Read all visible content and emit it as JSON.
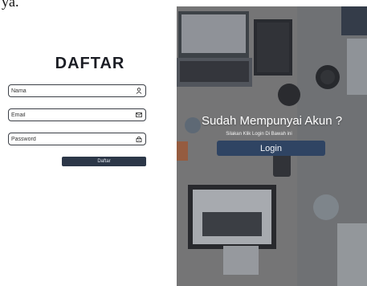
{
  "top_caption": "ya.",
  "register": {
    "title": "DAFTAR",
    "fields": [
      {
        "placeholder": "Nama",
        "icon": "user-icon"
      },
      {
        "placeholder": "Email",
        "icon": "mail-icon"
      },
      {
        "placeholder": "Password",
        "icon": "lock-icon"
      }
    ],
    "submit_label": "Daftar"
  },
  "login_panel": {
    "heading": "Sudah Mempunyai Akun ?",
    "subtext": "Silakan Klik Login Di Bawah ini",
    "button_label": "Login"
  },
  "colors": {
    "dark_button": "#2c3748",
    "login_button": "#2f4463",
    "text_dark": "#1b1d24"
  }
}
